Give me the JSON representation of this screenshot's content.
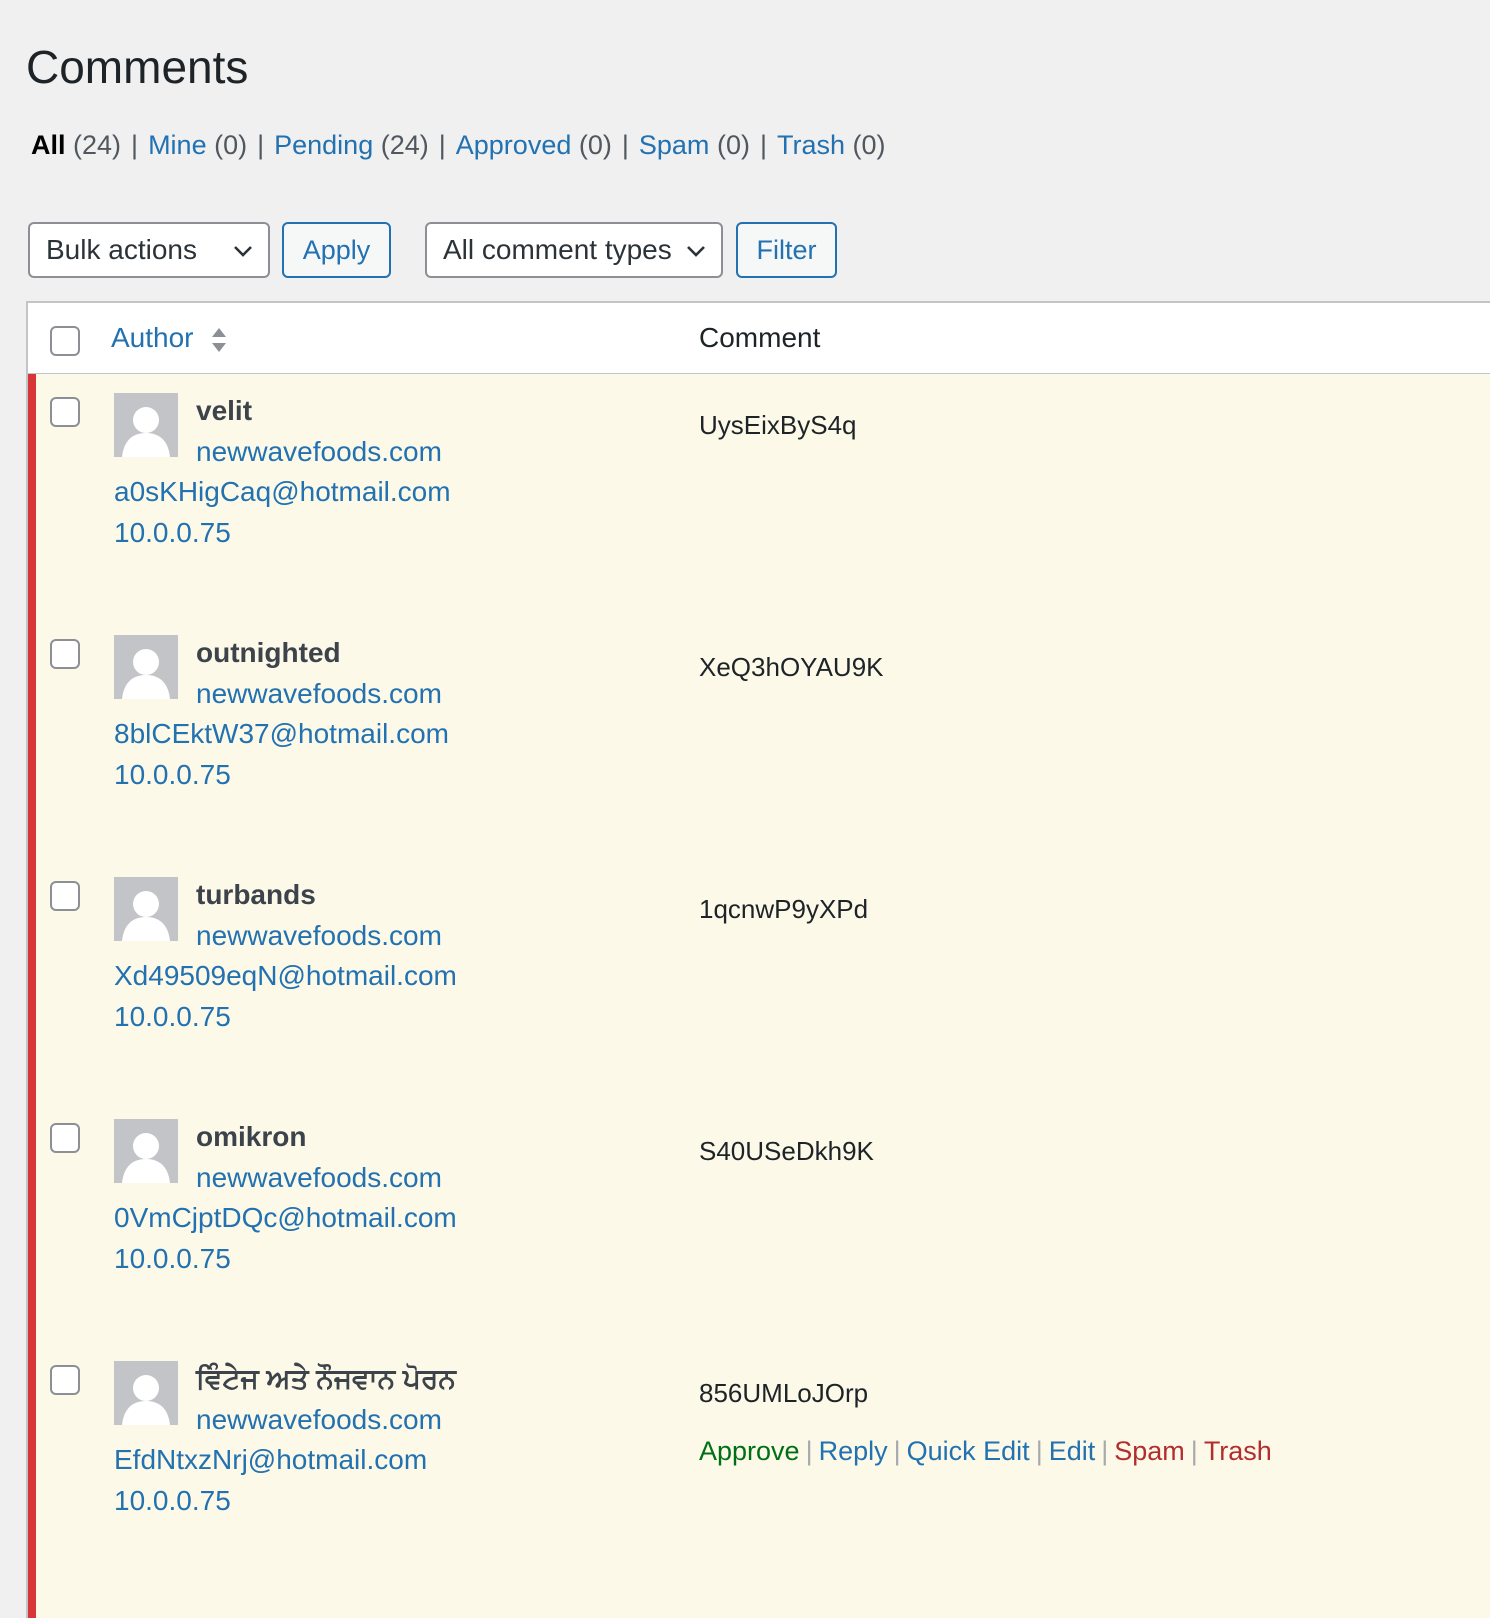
{
  "page": {
    "title": "Comments"
  },
  "views": [
    {
      "label": "All",
      "count": "(24)",
      "current": true
    },
    {
      "label": "Mine",
      "count": "(0)"
    },
    {
      "label": "Pending",
      "count": "(24)"
    },
    {
      "label": "Approved",
      "count": "(0)"
    },
    {
      "label": "Spam",
      "count": "(0)"
    },
    {
      "label": "Trash",
      "count": "(0)"
    }
  ],
  "toolbar": {
    "bulk_actions": "Bulk actions",
    "apply": "Apply",
    "comment_types": "All comment types",
    "filter": "Filter"
  },
  "table": {
    "col_author": "Author",
    "col_comment": "Comment"
  },
  "comments": [
    {
      "name": "velit",
      "url": "newwavefoods.com",
      "email": "a0sKHigCaq@hotmail.com",
      "ip": "10.0.0.75",
      "text": "UysEixByS4q"
    },
    {
      "name": "outnighted",
      "url": "newwavefoods.com",
      "email": "8blCEktW37@hotmail.com",
      "ip": "10.0.0.75",
      "text": "XeQ3hOYAU9K"
    },
    {
      "name": "turbands",
      "url": "newwavefoods.com",
      "email": "Xd49509eqN@hotmail.com",
      "ip": "10.0.0.75",
      "text": "1qcnwP9yXPd"
    },
    {
      "name": "omikron",
      "url": "newwavefoods.com",
      "email": "0VmCjptDQc@hotmail.com",
      "ip": "10.0.0.75",
      "text": "S40USeDkh9K"
    },
    {
      "name": "ਵਿੰਟੇਜ ਅਤੇ ਨੌਜਵਾਨ ਪੋਰਨ",
      "url": "newwavefoods.com",
      "email": "EfdNtxzNrj@hotmail.com",
      "ip": "10.0.0.75",
      "text": "856UMLoJOrp"
    }
  ],
  "row_actions": {
    "approve": "Approve",
    "reply": "Reply",
    "quick_edit": "Quick Edit",
    "edit": "Edit",
    "spam": "Spam",
    "trash": "Trash",
    "separator": "|"
  },
  "colors": {
    "link": "#2271b1",
    "pending_stripe": "#d63638",
    "pending_row_bg": "#fcf9e8",
    "approve": "#007017",
    "danger": "#b32d2e"
  },
  "icons": {
    "dropdown": "chevron-down-icon",
    "sort": "sort-arrows-icon",
    "avatar": "default-avatar-icon"
  }
}
